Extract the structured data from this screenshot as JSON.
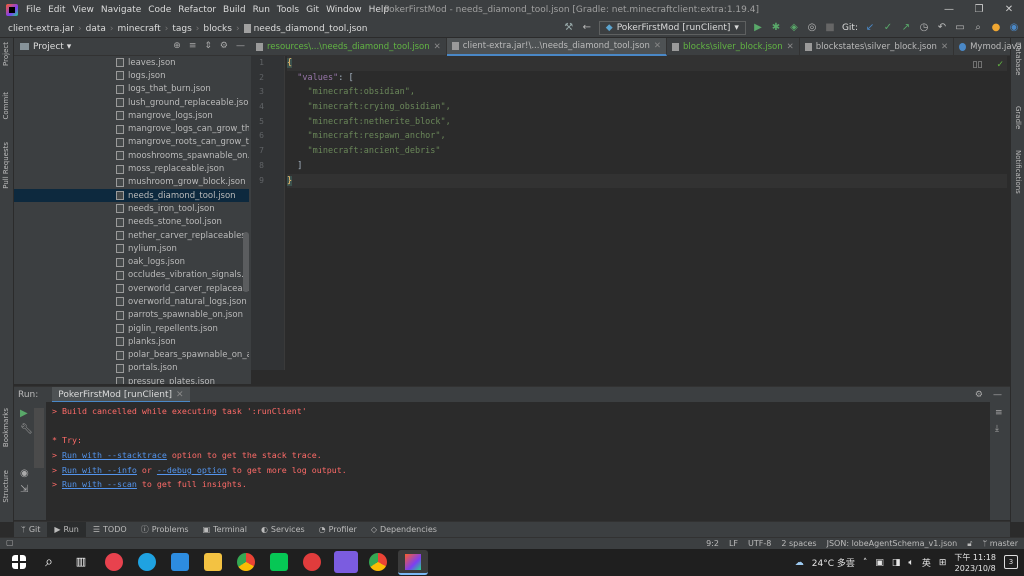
{
  "menubar": {
    "items": [
      "File",
      "Edit",
      "View",
      "Navigate",
      "Code",
      "Refactor",
      "Build",
      "Run",
      "Tools",
      "Git",
      "Window",
      "Help"
    ],
    "title": "PokerFirstMod - needs_diamond_tool.json [Gradle: net.minecraftclient:extra:1.19.4]"
  },
  "navbar": {
    "crumbs": [
      "client-extra.jar",
      "data",
      "minecraft",
      "tags",
      "blocks",
      "needs_diamond_tool.json"
    ],
    "run_config": "PokerFirstMod [runClient]",
    "git_label": "Git:"
  },
  "project": {
    "header": "Project",
    "files": [
      "leaves.json",
      "logs.json",
      "logs_that_burn.json",
      "lush_ground_replaceable.json",
      "mangrove_logs.json",
      "mangrove_logs_can_grow_throu",
      "mangrove_roots_can_grow_throu",
      "mooshrooms_spawnable_on.json",
      "moss_replaceable.json",
      "mushroom_grow_block.json",
      "needs_diamond_tool.json",
      "needs_iron_tool.json",
      "needs_stone_tool.json",
      "nether_carver_replaceables.json",
      "nylium.json",
      "oak_logs.json",
      "occludes_vibration_signals.json",
      "overworld_carver_replaceables.js",
      "overworld_natural_logs.json",
      "parrots_spawnable_on.json",
      "piglin_repellents.json",
      "planks.json",
      "polar_bears_spawnable_on_altern",
      "portals.json",
      "pressure_plates.json"
    ],
    "selected": "needs_diamond_tool.json"
  },
  "tabs": [
    {
      "label": "resources\\...\\needs_diamond_tool.json",
      "style": "green",
      "active": false
    },
    {
      "label": "client-extra.jar!\\...\\needs_diamond_tool.json",
      "style": "normal",
      "active": true
    },
    {
      "label": "blocks\\silver_block.json",
      "style": "green",
      "active": false
    },
    {
      "label": "blockstates\\silver_block.json",
      "style": "normal",
      "active": false
    },
    {
      "label": "Mymod.java",
      "style": "normal",
      "active": false
    }
  ],
  "editor": {
    "line_numbers": [
      "1",
      "2",
      "3",
      "4",
      "5",
      "6",
      "7",
      "8",
      "9"
    ],
    "values_key": "\"values\"",
    "values": [
      "\"minecraft:obsidian\",",
      "\"minecraft:crying_obsidian\",",
      "\"minecraft:netherite_block\",",
      "\"minecraft:respawn_anchor\",",
      "\"minecraft:ancient_debris\""
    ]
  },
  "run": {
    "label": "Run:",
    "tab": "PokerFirstMod [runClient]",
    "console": {
      "line1": "> Build cancelled while executing task ':runClient'",
      "try": "* Try:",
      "l3_pre": "> ",
      "l3_link": "Run with --stacktrace",
      "l3_post": " option to get the stack trace.",
      "l4_pre": "> ",
      "l4_link1": "Run with --info",
      "l4_mid": " or ",
      "l4_link2": "--debug option",
      "l4_post": " to get more log output.",
      "l5_pre": "> ",
      "l5_link": "Run with --scan",
      "l5_post": " to get full insights."
    }
  },
  "bottom_tabs": [
    "Git",
    "Run",
    "TODO",
    "Problems",
    "Terminal",
    "Services",
    "Profiler",
    "Dependencies"
  ],
  "status": {
    "position": "9:2",
    "line_sep": "LF",
    "encoding": "UTF-8",
    "indent": "2 spaces",
    "schema": "JSON: lobeAgentSchema_v1.json",
    "branch": "master"
  },
  "side_strips": {
    "left": [
      "Project",
      "Commit",
      "Pull Requests",
      "Bookmarks",
      "Structure"
    ],
    "right": [
      "Database",
      "Gradle",
      "Notifications"
    ]
  },
  "taskbar": {
    "weather": "24°C 多雲",
    "lang": "英",
    "time": "下午 11:18",
    "date": "2023/10/8",
    "notif_count": "3"
  }
}
